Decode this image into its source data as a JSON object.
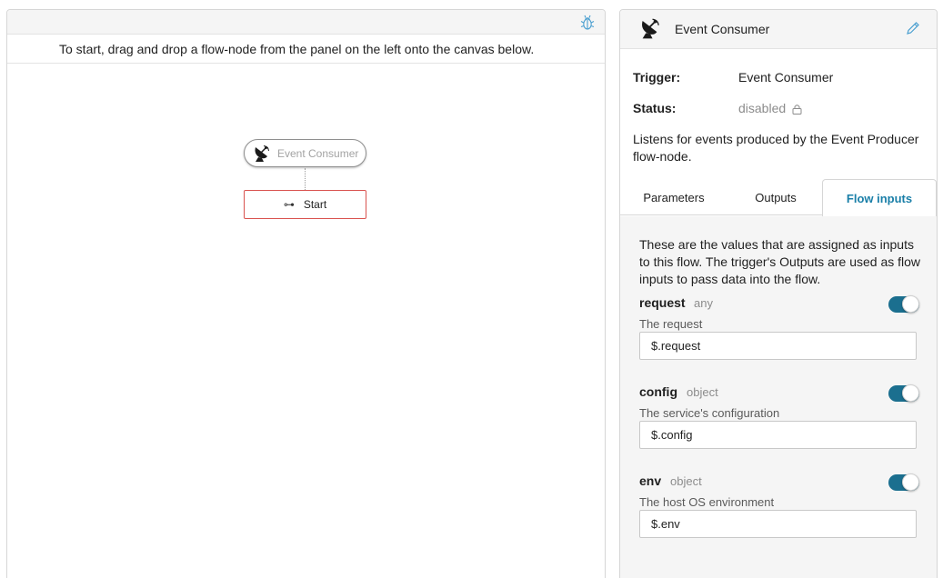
{
  "canvas": {
    "hint": "To start, drag and drop a flow-node from the panel on the left onto the canvas below.",
    "trigger_node_label": "Event Consumer",
    "start_node_label": "Start",
    "start_icon_glyph": "⊶"
  },
  "details": {
    "title": "Event Consumer",
    "trigger_key": "Trigger:",
    "trigger_value": "Event Consumer",
    "status_key": "Status:",
    "status_value": "disabled",
    "description": "Listens for events produced by the Event Producer flow-node.",
    "tabs": [
      {
        "label": "Parameters"
      },
      {
        "label": "Outputs"
      },
      {
        "label": "Flow inputs",
        "active": true
      }
    ],
    "flow_inputs": {
      "description": "These are the values that are assigned as inputs to this flow. The trigger's Outputs are used as flow inputs to pass data into the flow.",
      "items": [
        {
          "name": "request",
          "type": "any",
          "help": "The request",
          "value": "$.request",
          "enabled": true
        },
        {
          "name": "config",
          "type": "object",
          "help": "The service's configuration",
          "value": "$.config",
          "enabled": true
        },
        {
          "name": "env",
          "type": "object",
          "help": "The host OS environment",
          "value": "$.env",
          "enabled": true
        }
      ]
    }
  },
  "colors": {
    "accent": "#1a7fa8",
    "toggle_on": "#1b6f8f",
    "start_border": "#d9534f"
  },
  "icons": {
    "debug": "bug-icon",
    "trigger": "satellite-dish-icon",
    "edit": "pencil-icon",
    "lock": "lock-icon",
    "start": "link-arrow-icon"
  }
}
